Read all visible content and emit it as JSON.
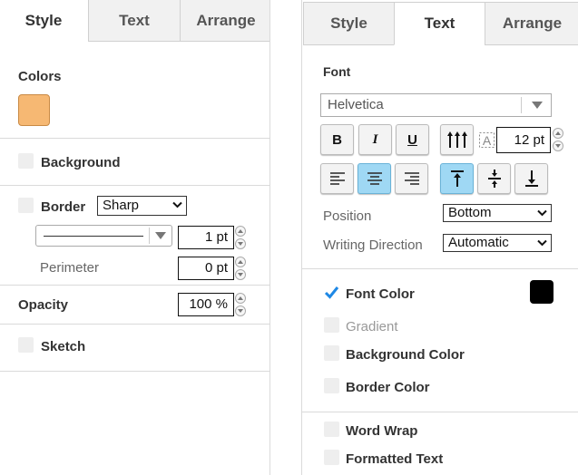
{
  "left": {
    "tabs": [
      "Style",
      "Text",
      "Arrange"
    ],
    "colors_label": "Colors",
    "fill_color": "#F6B873",
    "background_label": "Background",
    "border_label": "Border",
    "border_style": "Sharp",
    "line_width": "1 pt",
    "perimeter_label": "Perimeter",
    "perimeter_value": "0 pt",
    "opacity_label": "Opacity",
    "opacity_value": "100 %",
    "sketch_label": "Sketch"
  },
  "right": {
    "tabs": [
      "Style",
      "Text",
      "Arrange"
    ],
    "font_label": "Font",
    "font_family": "Helvetica",
    "bold_label": "B",
    "italic_label": "I",
    "underline_label": "U",
    "font_size": "12 pt",
    "position_label": "Position",
    "position_value": "Bottom",
    "writing_direction_label": "Writing Direction",
    "writing_direction_value": "Automatic",
    "font_color_label": "Font Color",
    "font_color": "#000000",
    "gradient_label": "Gradient",
    "background_color_label": "Background Color",
    "border_color_label": "Border Color",
    "word_wrap_label": "Word Wrap",
    "formatted_text_label": "Formatted Text"
  },
  "colors": {
    "active_button": "#9FD8F4",
    "checkbox_check": "#1E88E5"
  }
}
